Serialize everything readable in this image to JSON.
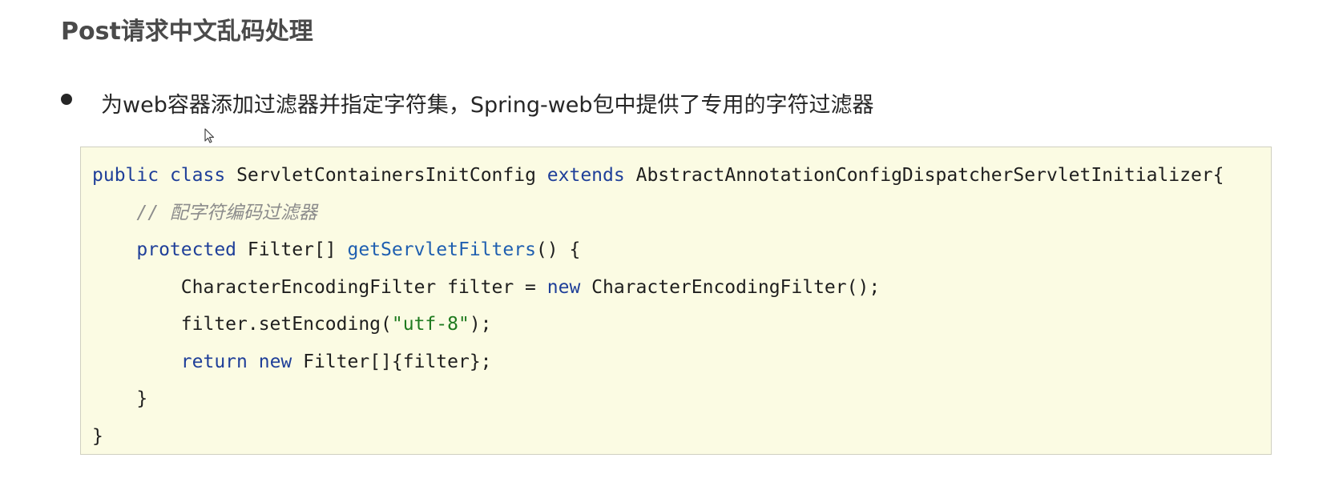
{
  "heading": "Post请求中文乱码处理",
  "bullet_text": "为web容器添加过滤器并指定字符集，Spring-web包中提供了专用的字符过滤器",
  "code": {
    "line1": {
      "kw_public": "public",
      "kw_class": "class",
      "class_name": "ServletContainersInitConfig",
      "kw_extends": "extends",
      "super_name": "AbstractAnnotationConfigDispatcherServletInitializer{"
    },
    "line2": {
      "comment": "// 配字符编码过滤器"
    },
    "line3": {
      "kw_protected": "protected",
      "type": "Filter[]",
      "method": "getServletFilters",
      "rest": "() {"
    },
    "line4": {
      "start": "CharacterEncodingFilter filter = ",
      "kw_new": "new",
      "end": " CharacterEncodingFilter();"
    },
    "line5": {
      "start": "filter.setEncoding(",
      "string": "\"utf-8\"",
      "end": ");"
    },
    "line6": {
      "kw_return": "return",
      "kw_new": "new",
      "end": " Filter[]{filter};"
    },
    "line7": {
      "brace": "}"
    },
    "line8": {
      "brace": "}"
    }
  },
  "colors": {
    "keyword": "#1f3f99",
    "method": "#1f5fb0",
    "string": "#1f7a1f",
    "comment": "#8c8c8c",
    "code_background": "#fbfbe3"
  },
  "icons": {
    "bullet": "filled-circle",
    "cursor": "mouse-pointer"
  }
}
